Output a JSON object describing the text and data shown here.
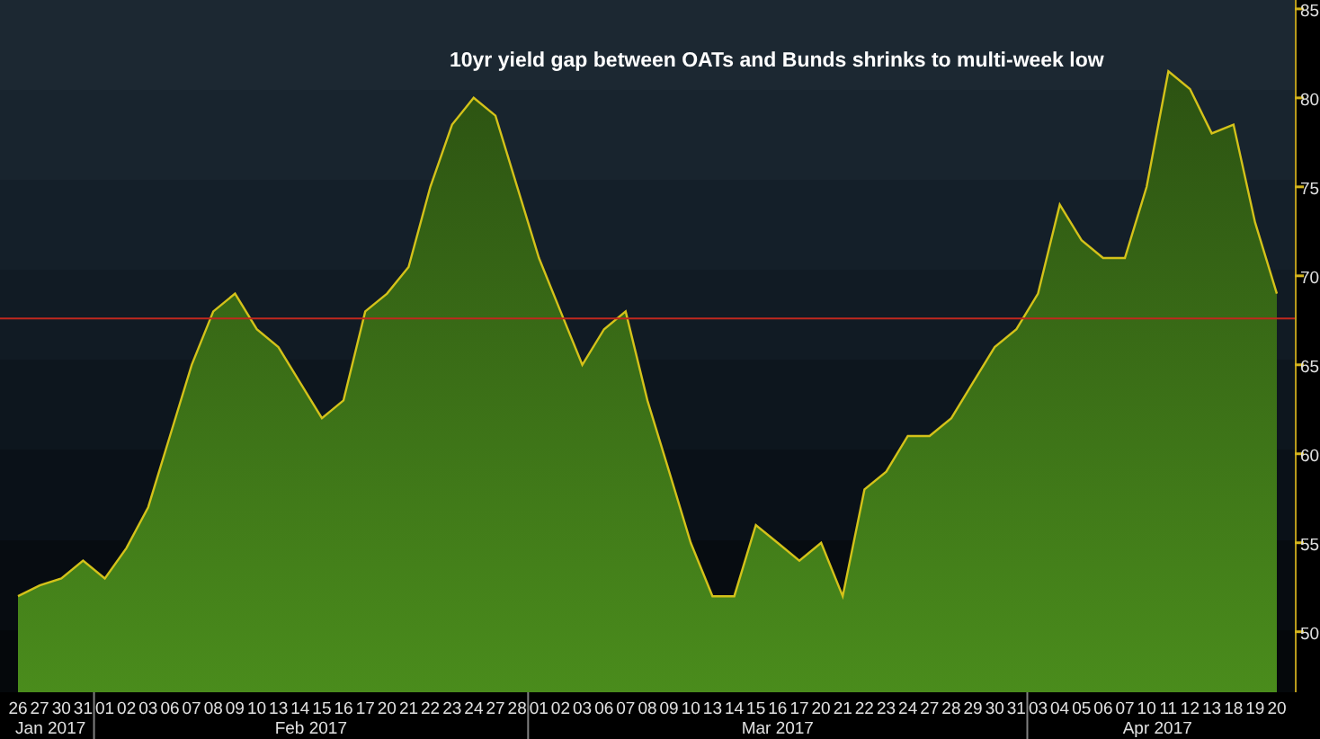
{
  "chart": {
    "chart_data": {
      "type": "area",
      "title": "10yr yield gap between OATs and Bunds shrinks to multi-week low",
      "series": [
        {
          "color": "#d4c21a",
          "values": [
            52,
            52.6,
            53,
            54,
            53,
            54.7,
            57,
            61,
            65,
            68,
            69,
            67,
            66,
            64,
            62,
            63,
            68,
            69,
            70.5,
            75,
            78.5,
            80,
            79,
            75,
            71,
            68,
            65,
            67,
            68,
            63,
            59,
            55,
            52,
            52,
            56,
            55,
            54,
            55,
            52,
            58,
            59,
            61,
            61,
            62,
            64,
            66,
            67,
            69,
            74,
            72,
            71,
            71,
            75,
            81.5,
            80.5,
            78,
            78.5,
            73,
            69
          ]
        }
      ],
      "ylim": [
        46.6,
        85.5
      ],
      "yticks": [
        50,
        55,
        60,
        65,
        70,
        75,
        80,
        85
      ],
      "ref_lines": [
        {
          "axis": "y",
          "value": 67.6,
          "color": "#c0281e"
        }
      ]
    },
    "months": [
      {
        "label": "Jan 2017",
        "days": [
          "26",
          "27",
          "30",
          "31"
        ]
      },
      {
        "label": "Feb 2017",
        "days": [
          "01",
          "02",
          "03",
          "06",
          "07",
          "08",
          "09",
          "10",
          "13",
          "14",
          "15",
          "16",
          "17",
          "20",
          "21",
          "22",
          "23",
          "24",
          "27",
          "28"
        ]
      },
      {
        "label": "Mar 2017",
        "days": [
          "01",
          "02",
          "03",
          "06",
          "07",
          "08",
          "09",
          "10",
          "13",
          "14",
          "15",
          "16",
          "17",
          "20",
          "21",
          "22",
          "23",
          "24",
          "27",
          "28",
          "29",
          "30",
          "31"
        ]
      },
      {
        "label": "Apr 2017",
        "days": [
          "03",
          "04",
          "05",
          "06",
          "07",
          "10",
          "11",
          "12",
          "13",
          "18",
          "19",
          "20"
        ]
      }
    ]
  }
}
